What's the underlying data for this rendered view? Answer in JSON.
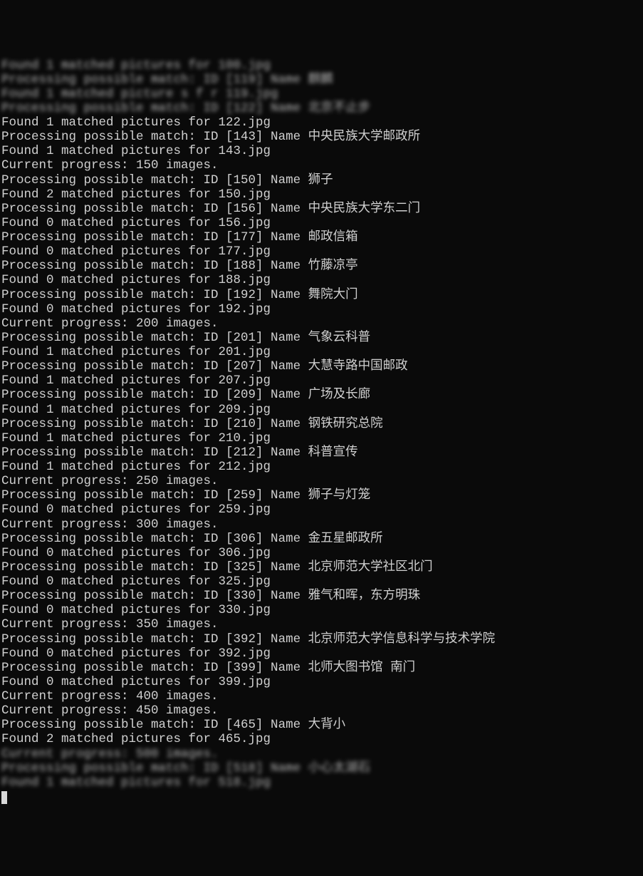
{
  "lines": [
    {
      "text": "Found 1 matched pictures for 100.jpg",
      "blurred": true
    },
    {
      "text": "Processing possible match: ID [119] Name 麒麟",
      "blurred": true
    },
    {
      "text": "Found 1 matched picture s f r 119.jpg",
      "blurred": true
    },
    {
      "text": "Processing possible match: ID [122] Name 北京不止步",
      "blurred": true
    },
    {
      "text": "Found 1 matched pictures for 122.jpg",
      "blurred": false
    },
    {
      "text": "Processing possible match: ID [143] Name 中央民族大学邮政所",
      "blurred": false
    },
    {
      "text": "Found 1 matched pictures for 143.jpg",
      "blurred": false
    },
    {
      "text": "Current progress: 150 images.",
      "blurred": false
    },
    {
      "text": "Processing possible match: ID [150] Name 狮子",
      "blurred": false
    },
    {
      "text": "Found 2 matched pictures for 150.jpg",
      "blurred": false
    },
    {
      "text": "Processing possible match: ID [156] Name 中央民族大学东二门",
      "blurred": false
    },
    {
      "text": "Found 0 matched pictures for 156.jpg",
      "blurred": false
    },
    {
      "text": "Processing possible match: ID [177] Name 邮政信箱",
      "blurred": false
    },
    {
      "text": "Found 0 matched pictures for 177.jpg",
      "blurred": false
    },
    {
      "text": "Processing possible match: ID [188] Name 竹藤凉亭",
      "blurred": false
    },
    {
      "text": "Found 0 matched pictures for 188.jpg",
      "blurred": false
    },
    {
      "text": "Processing possible match: ID [192] Name 舞院大门",
      "blurred": false
    },
    {
      "text": "Found 0 matched pictures for 192.jpg",
      "blurred": false
    },
    {
      "text": "Current progress: 200 images.",
      "blurred": false
    },
    {
      "text": "Processing possible match: ID [201] Name 气象云科普",
      "blurred": false
    },
    {
      "text": "Found 1 matched pictures for 201.jpg",
      "blurred": false
    },
    {
      "text": "Processing possible match: ID [207] Name 大慧寺路中国邮政",
      "blurred": false
    },
    {
      "text": "Found 1 matched pictures for 207.jpg",
      "blurred": false
    },
    {
      "text": "Processing possible match: ID [209] Name 广场及长廊",
      "blurred": false
    },
    {
      "text": "Found 1 matched pictures for 209.jpg",
      "blurred": false
    },
    {
      "text": "Processing possible match: ID [210] Name 钢铁研究总院",
      "blurred": false
    },
    {
      "text": "Found 1 matched pictures for 210.jpg",
      "blurred": false
    },
    {
      "text": "Processing possible match: ID [212] Name 科普宣传",
      "blurred": false
    },
    {
      "text": "Found 1 matched pictures for 212.jpg",
      "blurred": false
    },
    {
      "text": "Current progress: 250 images.",
      "blurred": false
    },
    {
      "text": "Processing possible match: ID [259] Name 狮子与灯笼",
      "blurred": false
    },
    {
      "text": "Found 0 matched pictures for 259.jpg",
      "blurred": false
    },
    {
      "text": "Current progress: 300 images.",
      "blurred": false
    },
    {
      "text": "Processing possible match: ID [306] Name 金五星邮政所",
      "blurred": false
    },
    {
      "text": "Found 0 matched pictures for 306.jpg",
      "blurred": false
    },
    {
      "text": "Processing possible match: ID [325] Name 北京师范大学社区北门",
      "blurred": false
    },
    {
      "text": "Found 0 matched pictures for 325.jpg",
      "blurred": false
    },
    {
      "text": "Processing possible match: ID [330] Name 雅气和晖，东方明珠",
      "blurred": false
    },
    {
      "text": "Found 0 matched pictures for 330.jpg",
      "blurred": false
    },
    {
      "text": "Current progress: 350 images.",
      "blurred": false
    },
    {
      "text": "Processing possible match: ID [392] Name 北京师范大学信息科学与技术学院",
      "blurred": false
    },
    {
      "text": "Found 0 matched pictures for 392.jpg",
      "blurred": false
    },
    {
      "text": "Processing possible match: ID [399] Name 北师大图书馆 南门",
      "blurred": false
    },
    {
      "text": "Found 0 matched pictures for 399.jpg",
      "blurred": false
    },
    {
      "text": "Current progress: 400 images.",
      "blurred": false
    },
    {
      "text": "Current progress: 450 images.",
      "blurred": false
    },
    {
      "text": "Processing possible match: ID [465] Name 大背小",
      "blurred": false
    },
    {
      "text": "Found 2 matched pictures for 465.jpg",
      "blurred": false
    },
    {
      "text": "Current progress: 500 images.",
      "blurred": true
    },
    {
      "text": "Processing possible match: ID [518] Name 小心太湖石",
      "blurred": true
    },
    {
      "text": "Found 1 matched pictures for 518.jpg",
      "blurred": true
    }
  ]
}
